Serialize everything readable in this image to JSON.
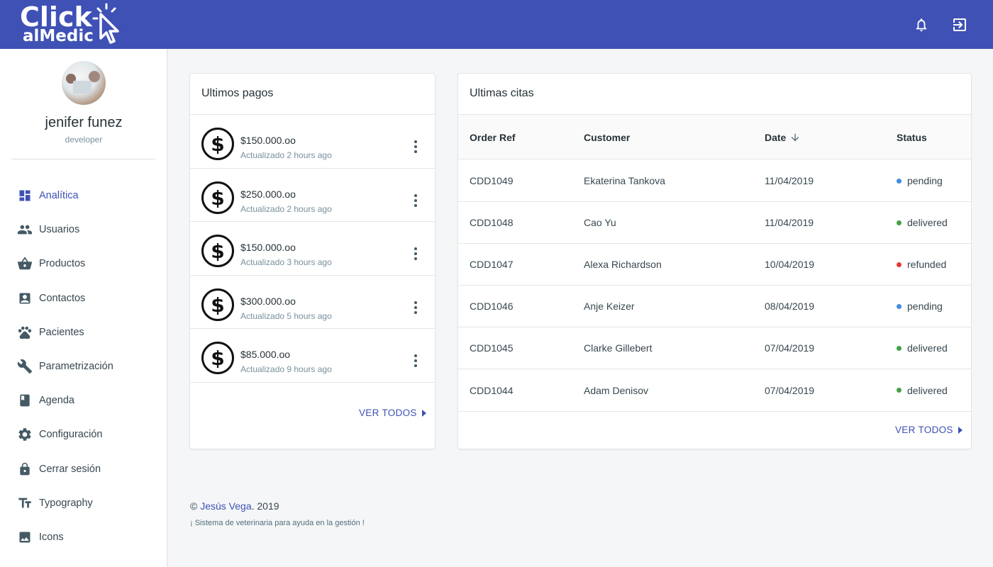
{
  "brand": {
    "line1": "Click",
    "line2": "alMedic"
  },
  "user": {
    "name": "jenifer funez",
    "role": "developer"
  },
  "nav": [
    {
      "label": "Analítica",
      "icon": "dashboard-icon"
    },
    {
      "label": "Usuarios",
      "icon": "people-icon"
    },
    {
      "label": "Productos",
      "icon": "shopping-basket-icon"
    },
    {
      "label": "Contactos",
      "icon": "contact-card-icon"
    },
    {
      "label": "Pacientes",
      "icon": "paw-icon"
    },
    {
      "label": "Parametrización",
      "icon": "wrench-icon"
    },
    {
      "label": "Agenda",
      "icon": "book-icon"
    },
    {
      "label": "Configuración",
      "icon": "gear-icon"
    },
    {
      "label": "Cerrar sesión",
      "icon": "lock-icon"
    },
    {
      "label": "Typography",
      "icon": "text-fields-icon"
    },
    {
      "label": "Icons",
      "icon": "image-icon"
    }
  ],
  "payments": {
    "title": "Ultimos pagos",
    "items": [
      {
        "amount": "$150.000.oo",
        "updated": "Actualizado 2 hours ago"
      },
      {
        "amount": "$250.000.oo",
        "updated": "Actualizado 2 hours ago"
      },
      {
        "amount": "$150.000.oo",
        "updated": "Actualizado 3 hours ago"
      },
      {
        "amount": "$300.000.oo",
        "updated": "Actualizado 5 hours ago"
      },
      {
        "amount": "$85.000.oo",
        "updated": "Actualizado 9 hours ago"
      }
    ],
    "view_all": "VER TODOS"
  },
  "appointments": {
    "title": "Ultimas citas",
    "columns": {
      "order": "Order Ref",
      "customer": "Customer",
      "date": "Date",
      "status": "Status"
    },
    "rows": [
      {
        "ref": "CDD1049",
        "customer": "Ekaterina Tankova",
        "date": "11/04/2019",
        "status": "pending"
      },
      {
        "ref": "CDD1048",
        "customer": "Cao Yu",
        "date": "11/04/2019",
        "status": "delivered"
      },
      {
        "ref": "CDD1047",
        "customer": "Alexa Richardson",
        "date": "10/04/2019",
        "status": "refunded"
      },
      {
        "ref": "CDD1046",
        "customer": "Anje Keizer",
        "date": "08/04/2019",
        "status": "pending"
      },
      {
        "ref": "CDD1045",
        "customer": "Clarke Gillebert",
        "date": "07/04/2019",
        "status": "delivered"
      },
      {
        "ref": "CDD1044",
        "customer": "Adam Denisov",
        "date": "07/04/2019",
        "status": "delivered"
      }
    ],
    "view_all": "VER TODOS"
  },
  "status_colors": {
    "pending": "#3f8ee0",
    "delivered": "#43a047",
    "refunded": "#e53935"
  },
  "footer": {
    "copyright": "©",
    "author": "Jesús Vega",
    "year": ". 2019",
    "tagline": "¡ Sistema de veterinaria para ayuda en la gestión !"
  }
}
